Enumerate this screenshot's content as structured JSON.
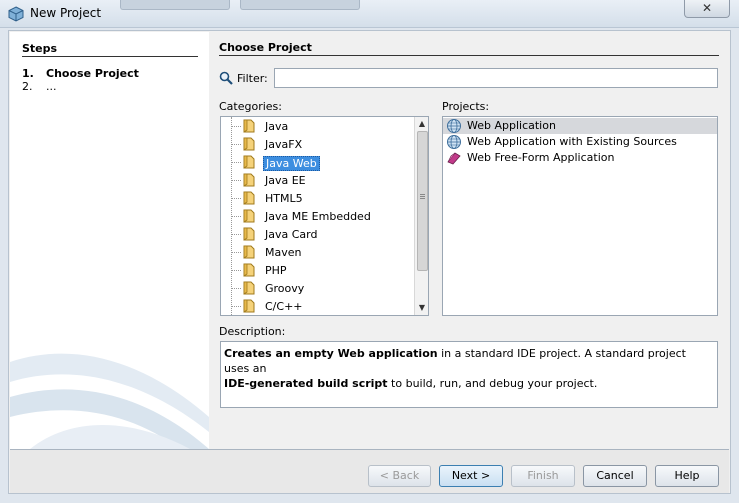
{
  "window": {
    "title": "New Project",
    "close_glyph": "✕"
  },
  "steps": {
    "title": "Steps",
    "items": [
      {
        "num": "1.",
        "label": "Choose Project",
        "active": true
      },
      {
        "num": "2.",
        "label": "...",
        "active": false
      }
    ]
  },
  "main": {
    "title": "Choose Project",
    "filter_label": "Filter:",
    "filter_value": "",
    "categories_label": "Categories:",
    "projects_label": "Projects:",
    "categories": [
      "Java",
      "JavaFX",
      "Java Web",
      "Java EE",
      "HTML5",
      "Java ME Embedded",
      "Java Card",
      "Maven",
      "PHP",
      "Groovy",
      "C/C++"
    ],
    "selected_category": "Java Web",
    "projects": [
      {
        "label": "Web Application",
        "icon": "globe-icon",
        "selected": true
      },
      {
        "label": "Web Application with Existing Sources",
        "icon": "globe-icon",
        "selected": false
      },
      {
        "label": "Web Free-Form Application",
        "icon": "free-form-icon",
        "selected": false
      }
    ],
    "description_label": "Description:",
    "description": {
      "p1_bold": "Creates an empty Web application",
      "p1_rest": " in a standard IDE project. A standard project uses an",
      "p2_bold": "IDE-generated build script",
      "p2_rest": " to build, run, and debug your project."
    }
  },
  "buttons": {
    "back": "< Back",
    "next": "Next >",
    "finish": "Finish",
    "cancel": "Cancel",
    "help": "Help"
  },
  "colors": {
    "selection": "#3d8ee0",
    "project_selection": "#d6d8dc",
    "frame_bg": "#f0f0f0"
  }
}
